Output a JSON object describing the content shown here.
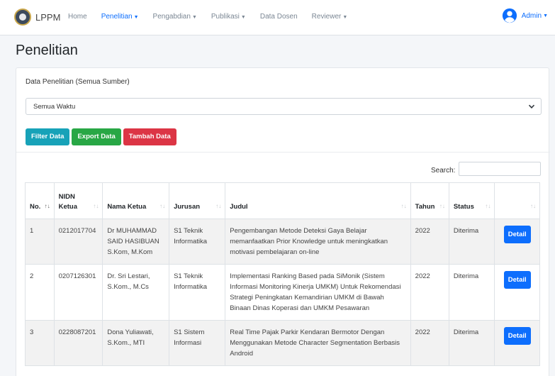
{
  "brand": {
    "name": "LPPM"
  },
  "nav": [
    {
      "label": "Home",
      "dropdown": false,
      "active": false
    },
    {
      "label": "Penelitian",
      "dropdown": true,
      "active": true
    },
    {
      "label": "Pengabdian",
      "dropdown": true,
      "active": false
    },
    {
      "label": "Publikasi",
      "dropdown": true,
      "active": false
    },
    {
      "label": "Data Dosen",
      "dropdown": false,
      "active": false
    },
    {
      "label": "Reviewer",
      "dropdown": true,
      "active": false
    }
  ],
  "user": {
    "label": "Admin"
  },
  "page": {
    "title": "Penelitian"
  },
  "card": {
    "title": "Data Penelitian (Semua Sumber)",
    "filter_select_value": "Semua Waktu",
    "buttons": {
      "filter": "Filter Data",
      "export": "Export Data",
      "add": "Tambah Data"
    },
    "search_label": "Search:"
  },
  "table": {
    "headers": {
      "no": "No.",
      "nidn_line1": "NIDN",
      "nidn_line2": "Ketua",
      "nama": "Nama Ketua",
      "jurusan": "Jurusan",
      "judul": "Judul",
      "tahun": "Tahun",
      "status": "Status"
    },
    "detail_label": "Detail",
    "rows": [
      {
        "no": "1",
        "nidn": "0212017704",
        "nama": "Dr MUHAMMAD SAID HASIBUAN S.Kom, M.Kom",
        "jurusan": "S1 Teknik Informatika",
        "judul": "Pengembangan Metode Deteksi Gaya Belajar memanfaatkan Prior Knowledge untuk meningkatkan motivasi pembelajaran on-line",
        "tahun": "2022",
        "status": "Diterima"
      },
      {
        "no": "2",
        "nidn": "0207126301",
        "nama": "Dr. Sri Lestari, S.Kom., M.Cs",
        "jurusan": "S1 Teknik Informatika",
        "judul": "Implementasi Ranking Based pada SiMonik (Sistem Informasi Monitoring Kinerja UMKM) Untuk Rekomendasi Strategi Peningkatan Kemandirian UMKM di Bawah Binaan Dinas Koperasi dan UMKM Pesawaran",
        "tahun": "2022",
        "status": "Diterima"
      },
      {
        "no": "3",
        "nidn": "0228087201",
        "nama": "Dona Yuliawati, S.Kom., MTI",
        "jurusan": "S1 Sistem Informasi",
        "judul": "Real Time Pajak Parkir Kendaran Bermotor Dengan Menggunakan Metode Character Segmentation Berbasis Android",
        "tahun": "2022",
        "status": "Diterima"
      }
    ]
  },
  "colors": {
    "primary": "#0d6efd",
    "info": "#17a2b8",
    "success": "#28a745",
    "danger": "#dc3545"
  },
  "icons": {
    "user": "user-circle-icon",
    "select": "chevron-down-icon",
    "sort": "sort-icon"
  }
}
